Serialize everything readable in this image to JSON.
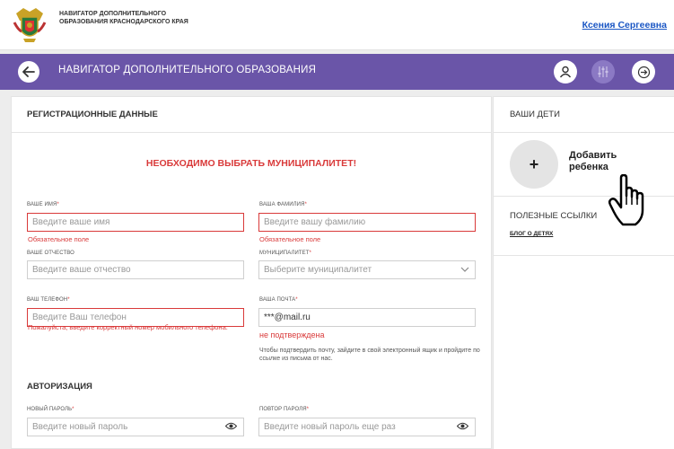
{
  "header": {
    "org_name": "НАВИГАТОР ДОПОЛНИТЕЛЬНОГО ОБРАЗОВАНИЯ КРАСНОДАРСКОГО КРАЯ",
    "user_name": "Ксения Сергеевна",
    "logo_icon": "coat-of-arms-icon"
  },
  "nav": {
    "title": "НАВИГАТОР ДОПОЛНИТЕЛЬНОГО ОБРАЗОВАНИЯ",
    "back_icon": "arrow-left-icon",
    "profile_icon": "user-icon",
    "settings_icon": "sliders-icon",
    "logout_icon": "logout-icon",
    "accent_color": "#6a55a8"
  },
  "registration": {
    "title": "РЕГИСТРАЦИОННЫЕ ДАННЫЕ",
    "alert": "НЕОБХОДИМО ВЫБРАТЬ МУНИЦИПАЛИТЕТ!",
    "first_name": {
      "label": "ВАШЕ ИМЯ",
      "required": "*",
      "placeholder": "Введите ваше имя",
      "error": "Обязательное поле"
    },
    "last_name": {
      "label": "ВАША ФАМИЛИЯ",
      "required": "*",
      "placeholder": "Введите вашу фамилию",
      "error": "Обязательное поле"
    },
    "patronymic": {
      "label": "ВАШЕ ОТЧЕСТВО",
      "placeholder": "Введите ваше отчество"
    },
    "municipality": {
      "label": "МУНИЦИПАЛИТЕТ",
      "required": "*",
      "placeholder": "Выберите муниципалитет"
    },
    "phone": {
      "label": "ВАШ ТЕЛЕФОН",
      "required": "*",
      "placeholder": "Введите Ваш телефон",
      "error": "Пожалуйста, введите корректный номер мобильного телефона."
    },
    "email": {
      "label": "ВАША ПОЧТА",
      "required": "*",
      "value": "***@mail.ru",
      "status": "не подтверждена",
      "hint": "Чтобы подтвердить почту, зайдите в свой электронный ящик и пройдите по ссылке из письма от нас."
    }
  },
  "auth": {
    "title": "АВТОРИЗАЦИЯ",
    "new_password": {
      "label": "НОВЫЙ ПАРОЛЬ",
      "required": "*",
      "placeholder": "Введите новый пароль"
    },
    "repeat_password": {
      "label": "ПОВТОР ПАРОЛЯ",
      "required": "*",
      "placeholder": "Введите новый пароль еще раз"
    }
  },
  "kids": {
    "title": "ВАШИ ДЕТИ",
    "add_label": "Добавить ребенка",
    "add_symbol": "+"
  },
  "links": {
    "title": "ПОЛЕЗНЫЕ ССЫЛКИ",
    "items": [
      {
        "label": "БЛОГ О ДЕТЯХ"
      }
    ]
  },
  "colors": {
    "error": "#d93a3a",
    "link": "#1a56c4"
  }
}
